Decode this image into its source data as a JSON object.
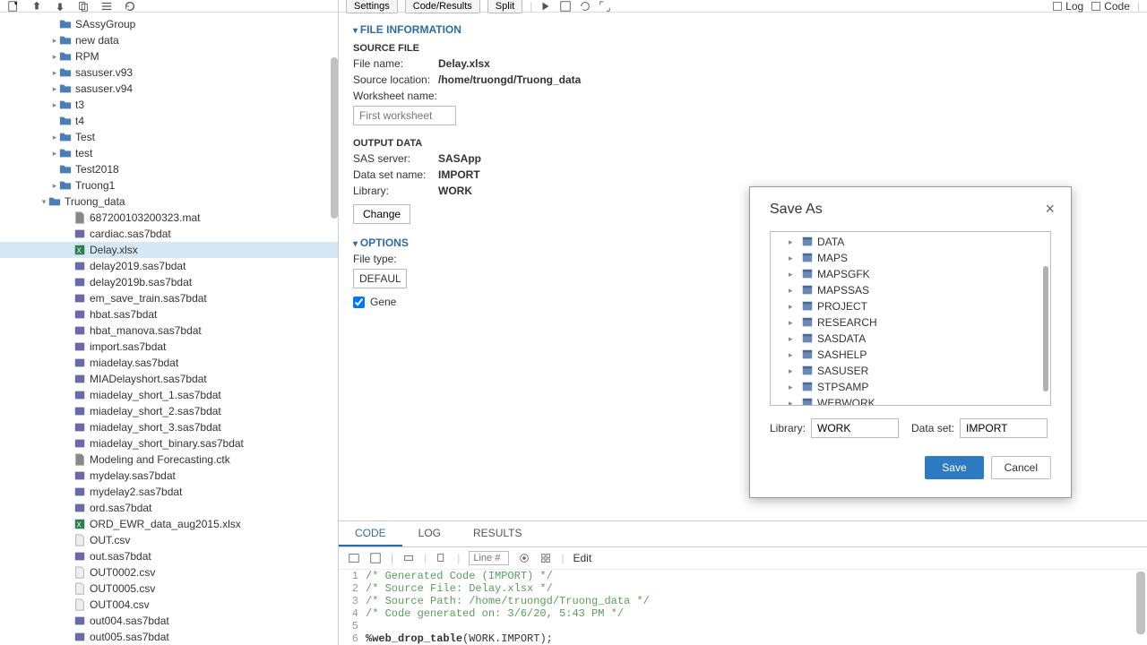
{
  "top_right_tabs": {
    "log": "Log",
    "code": "Code"
  },
  "sidebar_tree": [
    {
      "label": "SAssyGroup",
      "type": "folder",
      "indent": 56
    },
    {
      "label": "new data",
      "type": "folder",
      "indent": 56,
      "toggle": "▸"
    },
    {
      "label": "RPM",
      "type": "folder",
      "indent": 56,
      "toggle": "▸"
    },
    {
      "label": "sasuser.v93",
      "type": "folder",
      "indent": 56,
      "toggle": "▸"
    },
    {
      "label": "sasuser.v94",
      "type": "folder",
      "indent": 56,
      "toggle": "▸"
    },
    {
      "label": "t3",
      "type": "folder",
      "indent": 56,
      "toggle": "▸"
    },
    {
      "label": "t4",
      "type": "folder",
      "indent": 56
    },
    {
      "label": "Test",
      "type": "folder",
      "indent": 56,
      "toggle": "▸"
    },
    {
      "label": "test",
      "type": "folder",
      "indent": 56,
      "toggle": "▸"
    },
    {
      "label": "Test2018",
      "type": "folder",
      "indent": 56
    },
    {
      "label": "Truong1",
      "type": "folder",
      "indent": 56,
      "toggle": "▸"
    },
    {
      "label": "Truong_data",
      "type": "folder",
      "indent": 44,
      "toggle": "▾"
    },
    {
      "label": "687200103200323.mat",
      "type": "file",
      "indent": 72
    },
    {
      "label": "cardiac.sas7bdat",
      "type": "sas",
      "indent": 72
    },
    {
      "label": "Delay.xlsx",
      "type": "excel",
      "indent": 72,
      "selected": true
    },
    {
      "label": "delay2019.sas7bdat",
      "type": "sas",
      "indent": 72
    },
    {
      "label": "delay2019b.sas7bdat",
      "type": "sas",
      "indent": 72
    },
    {
      "label": "em_save_train.sas7bdat",
      "type": "sas",
      "indent": 72
    },
    {
      "label": "hbat.sas7bdat",
      "type": "sas",
      "indent": 72
    },
    {
      "label": "hbat_manova.sas7bdat",
      "type": "sas",
      "indent": 72
    },
    {
      "label": "import.sas7bdat",
      "type": "sas",
      "indent": 72
    },
    {
      "label": "miadelay.sas7bdat",
      "type": "sas",
      "indent": 72
    },
    {
      "label": "MIADelayshort.sas7bdat",
      "type": "sas",
      "indent": 72
    },
    {
      "label": "miadelay_short_1.sas7bdat",
      "type": "sas",
      "indent": 72
    },
    {
      "label": "miadelay_short_2.sas7bdat",
      "type": "sas",
      "indent": 72
    },
    {
      "label": "miadelay_short_3.sas7bdat",
      "type": "sas",
      "indent": 72
    },
    {
      "label": "miadelay_short_binary.sas7bdat",
      "type": "sas",
      "indent": 72
    },
    {
      "label": "Modeling and Forecasting.ctk",
      "type": "file",
      "indent": 72
    },
    {
      "label": "mydelay.sas7bdat",
      "type": "sas",
      "indent": 72
    },
    {
      "label": "mydelay2.sas7bdat",
      "type": "sas",
      "indent": 72
    },
    {
      "label": "ord.sas7bdat",
      "type": "sas",
      "indent": 72
    },
    {
      "label": "ORD_EWR_data_aug2015.xlsx",
      "type": "excel",
      "indent": 72
    },
    {
      "label": "OUT.csv",
      "type": "csv",
      "indent": 72
    },
    {
      "label": "out.sas7bdat",
      "type": "sas",
      "indent": 72
    },
    {
      "label": "OUT0002.csv",
      "type": "csv",
      "indent": 72
    },
    {
      "label": "OUT0005.csv",
      "type": "csv",
      "indent": 72
    },
    {
      "label": "OUT004.csv",
      "type": "csv",
      "indent": 72
    },
    {
      "label": "out004.sas7bdat",
      "type": "sas",
      "indent": 72
    },
    {
      "label": "out005.sas7bdat",
      "type": "sas",
      "indent": 72
    }
  ],
  "main_toolbar": {
    "settings": "Settings",
    "coderesults": "Code/Results",
    "split": "Split"
  },
  "file_info": {
    "header": "FILE INFORMATION",
    "source_file": "SOURCE FILE",
    "file_name_label": "File name:",
    "file_name": "Delay.xlsx",
    "source_loc_label": "Source location:",
    "source_loc": "/home/truongd/Truong_data",
    "worksheet_label": "Worksheet name:",
    "worksheet_placeholder": "First worksheet",
    "output_data": "OUTPUT DATA",
    "sas_server_label": "SAS server:",
    "sas_server": "SASApp",
    "dataset_label": "Data set name:",
    "dataset": "IMPORT",
    "library_label": "Library:",
    "library": "WORK",
    "change_btn": "Change"
  },
  "options": {
    "header": "OPTIONS",
    "file_type_label": "File type:",
    "file_type": "DEFAULT",
    "generate_label": "Gene"
  },
  "modal": {
    "title": "Save As",
    "libraries": [
      "DATA",
      "MAPS",
      "MAPSGFK",
      "MAPSSAS",
      "PROJECT",
      "RESEARCH",
      "SASDATA",
      "SASHELP",
      "SASUSER",
      "STPSAMP",
      "WEBWORK"
    ],
    "library_label": "Library:",
    "library_value": "WORK",
    "dataset_label": "Data set:",
    "dataset_value": "IMPORT",
    "save": "Save",
    "cancel": "Cancel"
  },
  "code_tabs": {
    "code": "CODE",
    "log": "LOG",
    "results": "RESULTS"
  },
  "code_toolbar": {
    "line_placeholder": "Line #",
    "edit": "Edit"
  },
  "code_lines": [
    "/* Generated Code (IMPORT) */",
    "/* Source File: Delay.xlsx */",
    "/* Source Path: /home/truongd/Truong_data */",
    "/* Code generated on: 3/6/20, 5:43 PM */",
    "",
    "%web_drop_table(WORK.IMPORT);"
  ]
}
